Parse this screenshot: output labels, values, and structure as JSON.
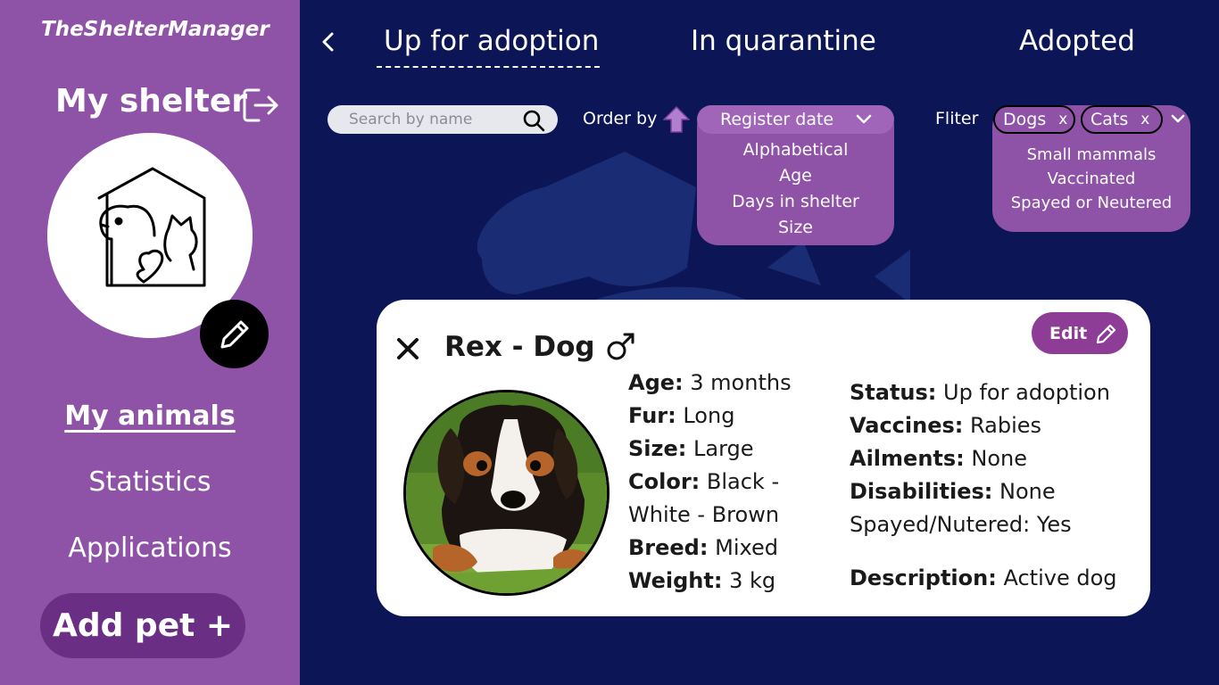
{
  "app": {
    "brand": "TheShelterManager",
    "shelter_title": "My shelter"
  },
  "sidebar": {
    "items": [
      {
        "label": "My animals",
        "active": true
      },
      {
        "label": "Statistics",
        "active": false
      },
      {
        "label": "Applications",
        "active": false
      }
    ],
    "add_pet_label": "Add pet +"
  },
  "tabs": [
    {
      "label": "Up for adoption",
      "active": true
    },
    {
      "label": "In quarantine",
      "active": false
    },
    {
      "label": "Adopted",
      "active": false
    }
  ],
  "search": {
    "placeholder": "Search by name",
    "value": ""
  },
  "order": {
    "label": "Order by",
    "selected": "Register date",
    "options": [
      "Alphabetical",
      "Age",
      "Days in shelter",
      "Size"
    ]
  },
  "filter": {
    "label": "Fliter",
    "chips": [
      "Dogs",
      "Cats"
    ],
    "chip_remove": "x",
    "options": [
      "Small mammals",
      "Vaccinated",
      "Spayed or Neutered"
    ]
  },
  "pet": {
    "name": "Rex - Dog",
    "edit_label": "Edit",
    "left_fields": [
      {
        "key": "Age:",
        "value": "3 months"
      },
      {
        "key": "Fur:",
        "value": "Long"
      },
      {
        "key": "Size:",
        "value": "Large"
      },
      {
        "key": "Color:",
        "value": "Black -"
      },
      {
        "key": "",
        "value": "White - Brown"
      },
      {
        "key": "Breed:",
        "value": "Mixed"
      },
      {
        "key": "Weight:",
        "value": "3 kg"
      }
    ],
    "right_fields": [
      {
        "key": "Status:",
        "value": "Up for adoption"
      },
      {
        "key": "Vaccines:",
        "value": "Rabies"
      },
      {
        "key": "Ailments:",
        "value": "None"
      },
      {
        "key": "Disabilities:",
        "value": "None"
      },
      {
        "key": "",
        "value": "Spayed/Nutered: Yes"
      },
      {
        "key": "Description:",
        "value": "Active dog"
      }
    ]
  },
  "colors": {
    "sidebar": "#8e52a6",
    "background": "#0c1656",
    "accent": "#8e3d96"
  },
  "icons": [
    "logout-icon",
    "shelter-logo-icon",
    "pencil-icon",
    "back-chevron-icon",
    "search-icon",
    "arrow-up-icon",
    "chevron-down-icon",
    "close-icon",
    "male-icon"
  ]
}
